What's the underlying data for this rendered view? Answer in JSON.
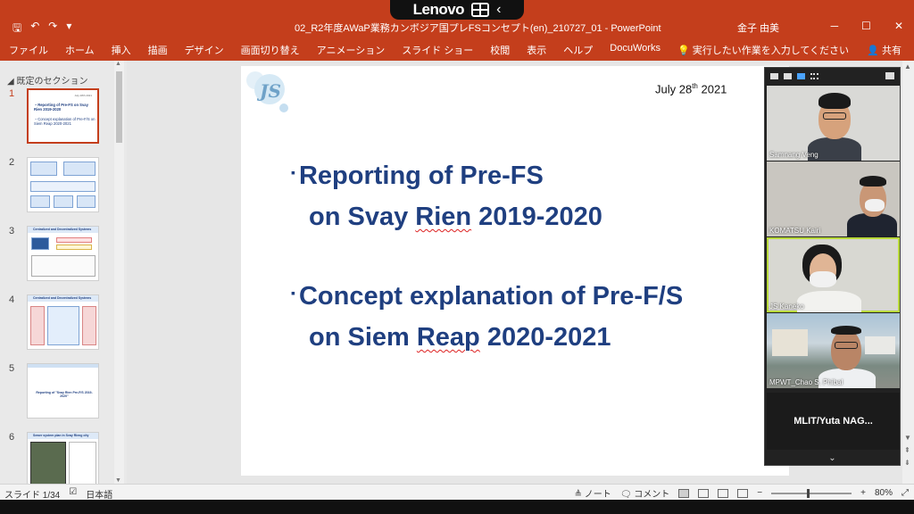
{
  "overlay": {
    "brand": "Lenovo",
    "back_glyph": "‹"
  },
  "titlebar": {
    "doc_title": "02_R2年度AWaP業務カンボジア国プレFSコンセプト(en)_210727_01 - PowerPoint",
    "user": "金子 由美",
    "qa": {
      "save": "🖫",
      "undo": "↶",
      "redo": "↷",
      "more": "▾"
    },
    "win": {
      "min": "─",
      "max": "☐",
      "close": "✕"
    }
  },
  "ribbon": {
    "tabs": [
      "ファイル",
      "ホーム",
      "挿入",
      "描画",
      "デザイン",
      "画面切り替え",
      "アニメーション",
      "スライド ショー",
      "校閲",
      "表示",
      "ヘルプ",
      "DocuWorks",
      "💡 実行したい作業を入力してください"
    ],
    "share": "共有"
  },
  "left_panel": {
    "section": "◢ 既定のセクション",
    "thumbs": [
      {
        "num": "1",
        "title": "・Reporting of Pre-FS on Svay Rien 2019-2020",
        "sub": "・Concept explanation of Pre-F/S on Siem Reap 2020-2021",
        "date": "July 28th 2021"
      },
      {
        "num": "2"
      },
      {
        "num": "3",
        "title": "Centralized and Decentralized Systems"
      },
      {
        "num": "4",
        "title": "Centralized and Decentralized Systems"
      },
      {
        "num": "5",
        "center": "Reporting of \"Svay Rien Pre-F/S 2019-2020\""
      },
      {
        "num": "6",
        "title": "Sewer system plan in Svay Rieng city"
      }
    ]
  },
  "slide": {
    "date_main": "July 28",
    "date_sup": "th",
    "date_year": " 2021",
    "bullet": "▪",
    "item1": {
      "line1": "Reporting of Pre-FS",
      "line2a": "on Svay ",
      "line2_squiggle": "Rien",
      "line2b": " 2019-2020"
    },
    "item2": {
      "line1": "Concept explanation of Pre-F/S",
      "line2a": "on Siem ",
      "line2_squiggle": "Reap",
      "line2b": " 2020-2021"
    }
  },
  "zoom": {
    "participants": [
      "Samnang Veng",
      "KOMATSU Kairi",
      "JS Kaneko",
      "MPWT_Chao S. Phibal"
    ],
    "name_tile": "MLIT/Yuta  NAG...",
    "more": "⌄"
  },
  "statusbar": {
    "slide_info": "スライド 1/34",
    "lang": "日本語",
    "notes": "≜ ノート",
    "comments": "🗨 コメント",
    "zoom_minus": "−",
    "zoom_plus": "+",
    "zoom_level": "80%"
  }
}
